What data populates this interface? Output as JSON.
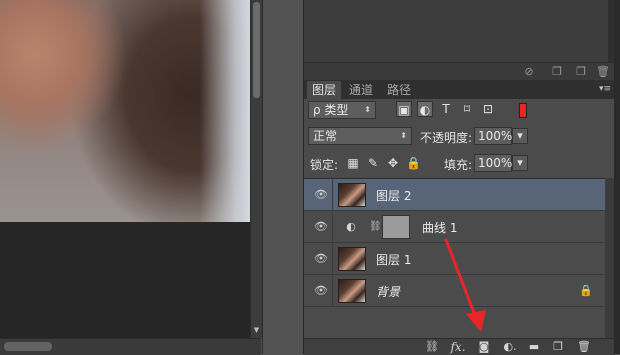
{
  "upper_footer": {
    "icons": [
      "no-icon",
      "new-icon",
      "new-icon",
      "trash-icon"
    ]
  },
  "layers_panel": {
    "tabs": [
      {
        "label": "图层",
        "active": true
      },
      {
        "label": "通道",
        "active": false
      },
      {
        "label": "路径",
        "active": false
      }
    ],
    "filter": {
      "selected": "ρ 类型"
    },
    "blend_mode": "正常",
    "opacity_label": "不透明度:",
    "opacity_value": "100%",
    "lock_label": "锁定:",
    "fill_label": "填充:",
    "fill_value": "100%",
    "layers": [
      {
        "name": "图层 2",
        "selected": true,
        "type": "pixel"
      },
      {
        "name": "曲线 1",
        "selected": false,
        "type": "adjustment"
      },
      {
        "name": "图层 1",
        "selected": false,
        "type": "pixel"
      },
      {
        "name": "背景",
        "selected": false,
        "type": "background",
        "locked": true
      }
    ],
    "bottom_icons": [
      "link-icon",
      "fx-icon",
      "add-mask-icon",
      "adjustment-icon",
      "group-icon",
      "new-layer-icon",
      "trash-icon"
    ]
  },
  "colors": {
    "selected_row": "#586478",
    "panel_bg": "#4b4b4b",
    "arrow": "#e8262a"
  }
}
